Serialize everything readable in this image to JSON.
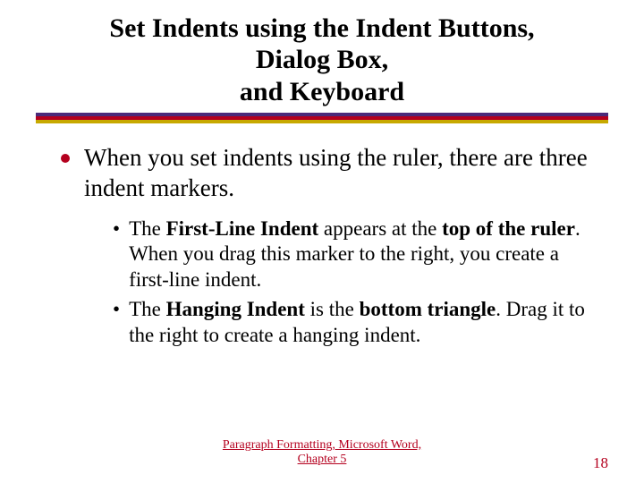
{
  "title": {
    "line1": "Set Indents using the Indent Buttons,",
    "line2": "Dialog Box,",
    "line3": "and Keyboard"
  },
  "bullets": {
    "l1": "When you set indents using the ruler, there are three indent markers.",
    "l2a": {
      "pre": "The ",
      "bold1": "First-Line Indent",
      "mid1": " appears at the ",
      "bold2": "top of the ruler",
      "post": ".  When you drag this marker to the right, you create a first-line indent."
    },
    "l2b": {
      "pre": "The ",
      "bold1": "Hanging Indent",
      "mid1": " is the ",
      "bold2": "bottom triangle",
      "post": ". Drag it to the right to create a hanging indent."
    }
  },
  "footer": {
    "center": "Paragraph Formatting, Microsoft Word, Chapter 5",
    "page": "18"
  },
  "colors": {
    "purple": "#4b2a7a",
    "red": "#b4001e",
    "gold": "#c7a900"
  }
}
